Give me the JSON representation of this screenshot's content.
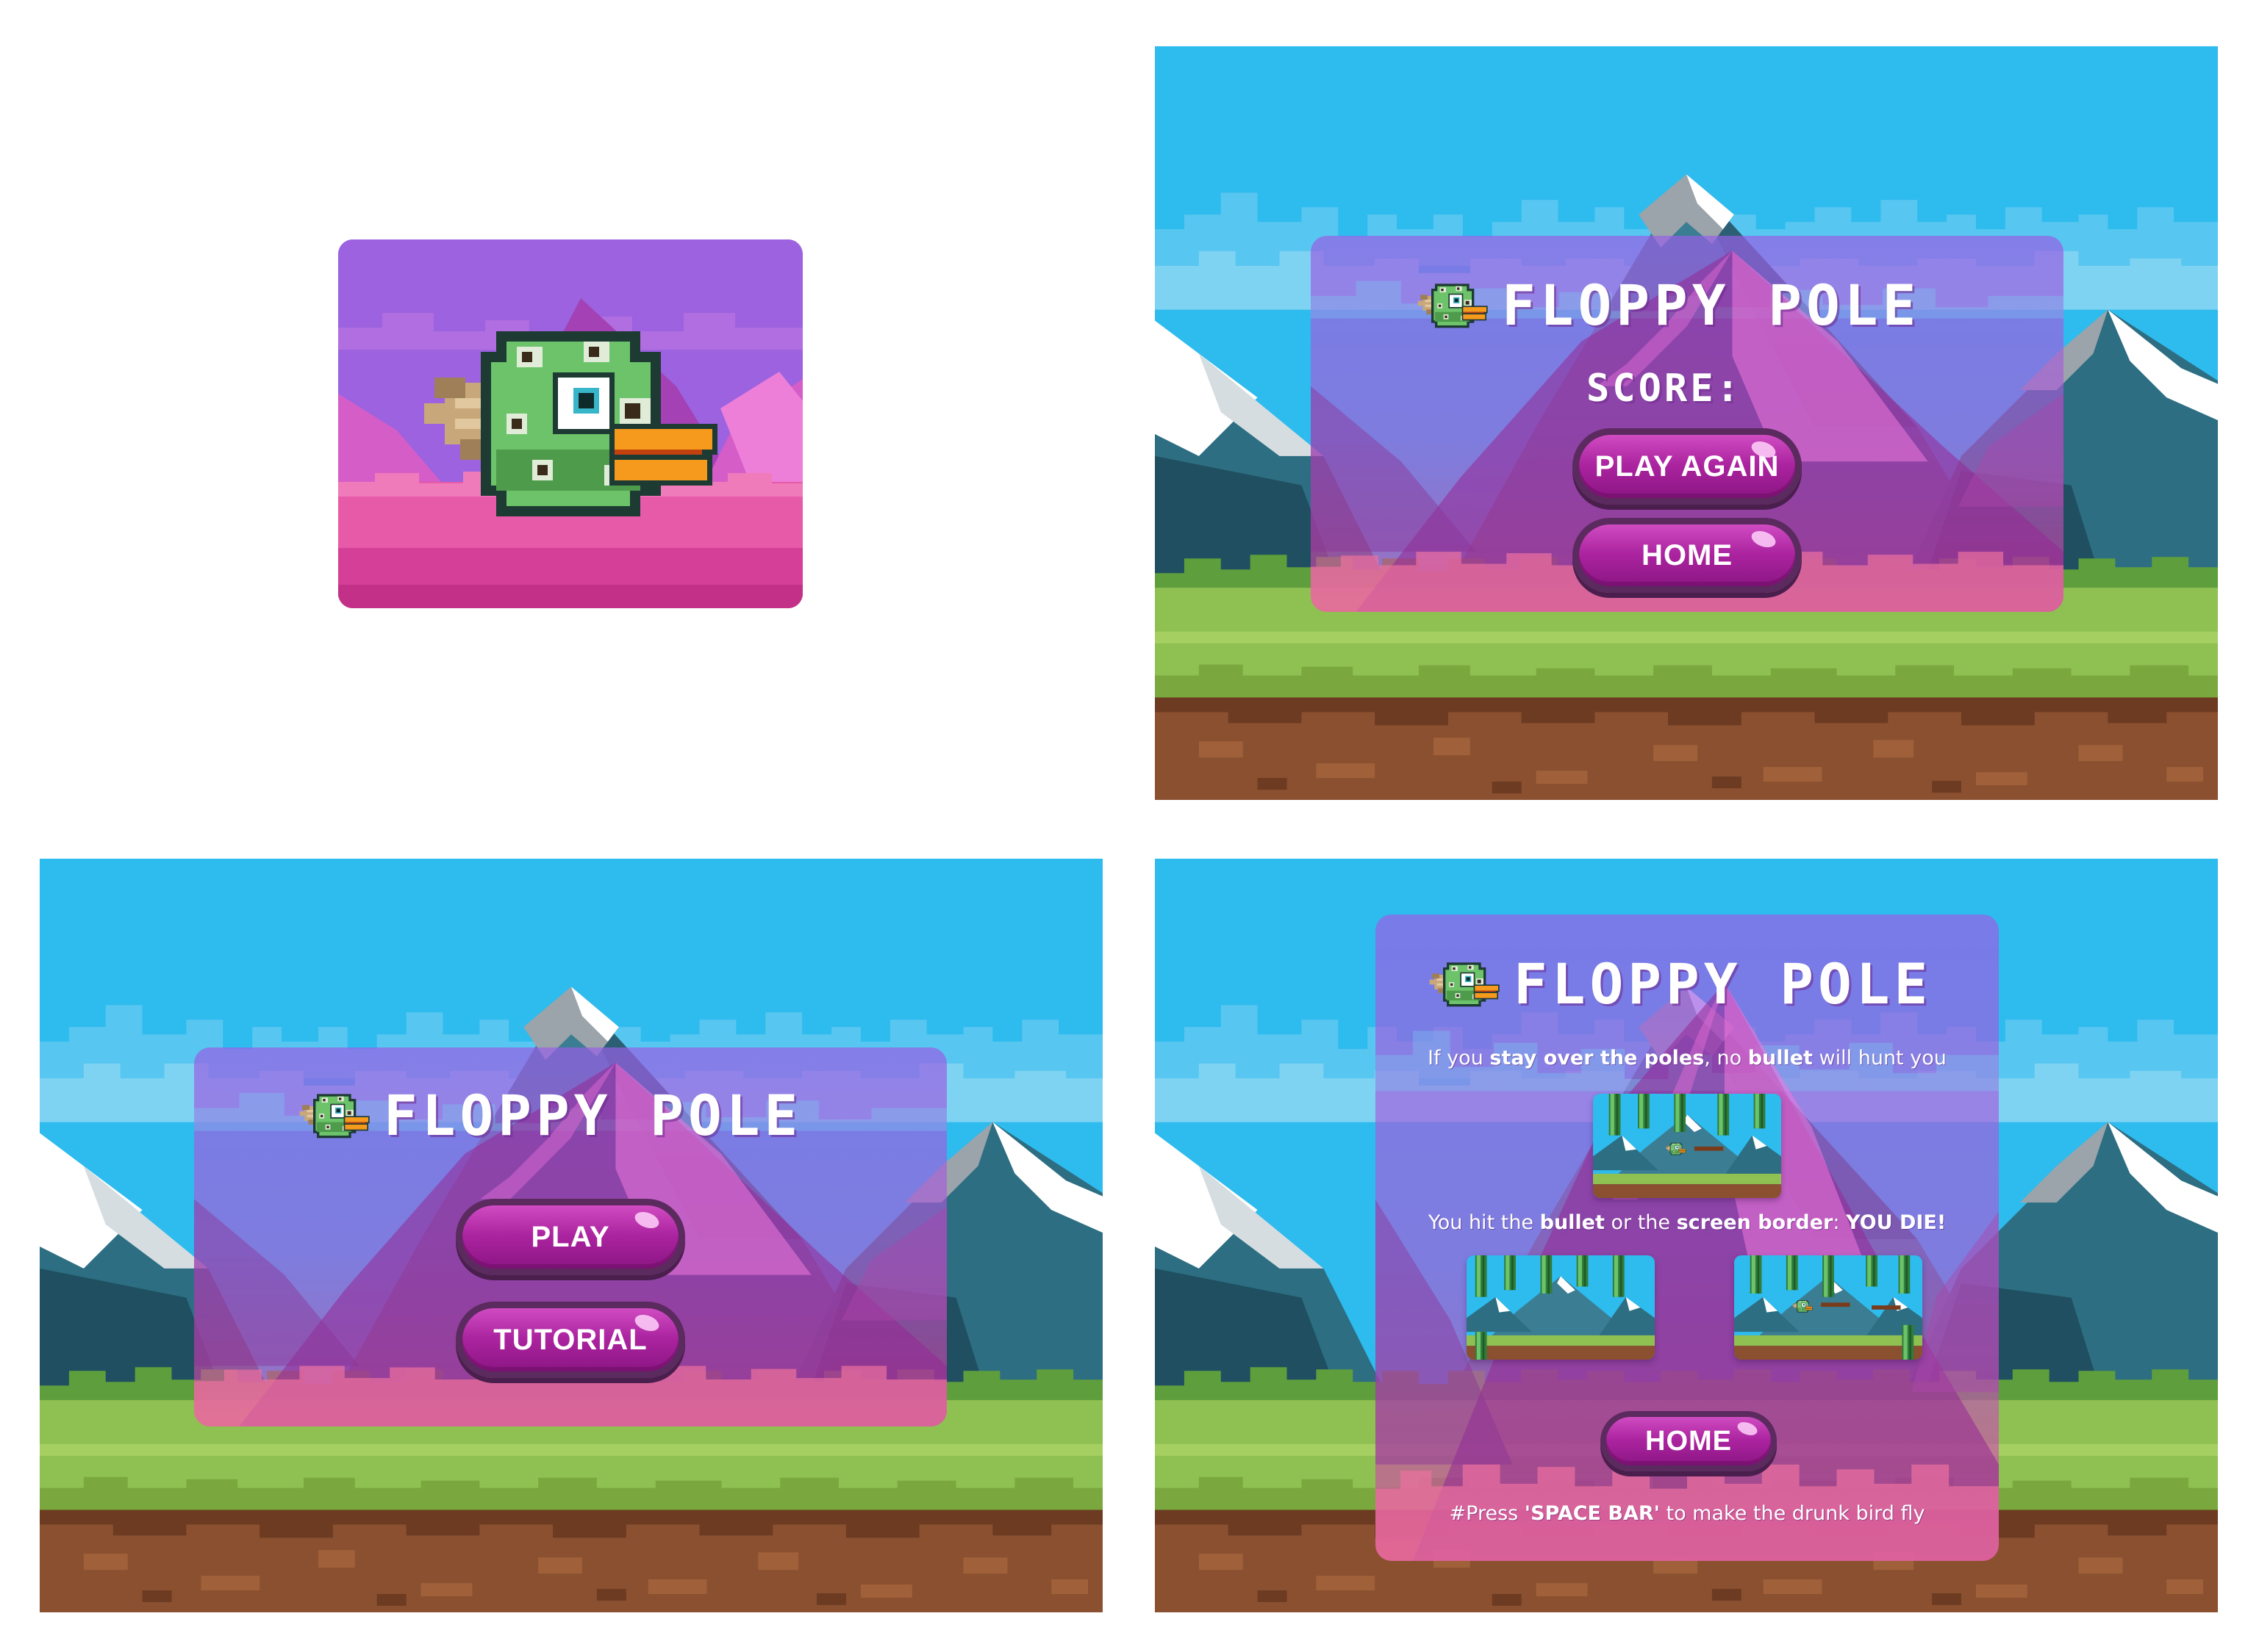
{
  "game": {
    "title": "FLOPPY POLE"
  },
  "colors": {
    "sky": "#2ebbee",
    "panel_purple": "#9760e6",
    "button_magenta": "#ab239f",
    "button_border": "#5b2a5e",
    "grass": "#8fc052",
    "dirt": "#8a5030",
    "bird_green": "#6cc36a",
    "beak_orange": "#f59a1c"
  },
  "icons": {
    "bird": "bird-mascot-icon"
  },
  "game_over_screen": {
    "score_label": "SCORE:",
    "play_again_label": "PLAY AGAIN",
    "home_label": "HOME"
  },
  "menu_screen": {
    "play_label": "PLAY",
    "tutorial_label": "TUTORIAL"
  },
  "tutorial_screen": {
    "tip1": {
      "part1": "If you ",
      "bold1": "stay over the poles",
      "part2": ", no ",
      "bold2": "bullet",
      "part3": " will hunt you"
    },
    "tip2": {
      "part1": "You hit the ",
      "bold1": "bullet",
      "part2": " or the ",
      "bold2": "screen border",
      "part3": ": ",
      "bold3": "YOU DIE!"
    },
    "home_label": "HOME",
    "footer": {
      "part1": "#Press ",
      "bold1": "'SPACE BAR'",
      "part2": " to make the drunk bird fly"
    }
  }
}
